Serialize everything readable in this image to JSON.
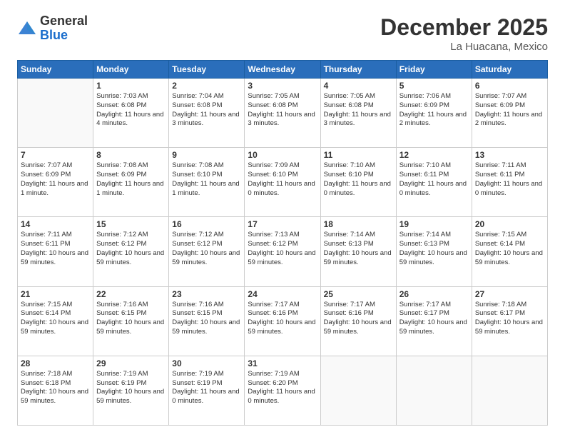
{
  "header": {
    "logo_general": "General",
    "logo_blue": "Blue",
    "month_title": "December 2025",
    "location": "La Huacana, Mexico"
  },
  "calendar": {
    "days_of_week": [
      "Sunday",
      "Monday",
      "Tuesday",
      "Wednesday",
      "Thursday",
      "Friday",
      "Saturday"
    ],
    "weeks": [
      [
        {
          "day": "",
          "info": ""
        },
        {
          "day": "1",
          "info": "Sunrise: 7:03 AM\nSunset: 6:08 PM\nDaylight: 11 hours\nand 4 minutes."
        },
        {
          "day": "2",
          "info": "Sunrise: 7:04 AM\nSunset: 6:08 PM\nDaylight: 11 hours\nand 3 minutes."
        },
        {
          "day": "3",
          "info": "Sunrise: 7:05 AM\nSunset: 6:08 PM\nDaylight: 11 hours\nand 3 minutes."
        },
        {
          "day": "4",
          "info": "Sunrise: 7:05 AM\nSunset: 6:08 PM\nDaylight: 11 hours\nand 3 minutes."
        },
        {
          "day": "5",
          "info": "Sunrise: 7:06 AM\nSunset: 6:09 PM\nDaylight: 11 hours\nand 2 minutes."
        },
        {
          "day": "6",
          "info": "Sunrise: 7:07 AM\nSunset: 6:09 PM\nDaylight: 11 hours\nand 2 minutes."
        }
      ],
      [
        {
          "day": "7",
          "info": "Sunrise: 7:07 AM\nSunset: 6:09 PM\nDaylight: 11 hours\nand 1 minute."
        },
        {
          "day": "8",
          "info": "Sunrise: 7:08 AM\nSunset: 6:09 PM\nDaylight: 11 hours\nand 1 minute."
        },
        {
          "day": "9",
          "info": "Sunrise: 7:08 AM\nSunset: 6:10 PM\nDaylight: 11 hours\nand 1 minute."
        },
        {
          "day": "10",
          "info": "Sunrise: 7:09 AM\nSunset: 6:10 PM\nDaylight: 11 hours\nand 0 minutes."
        },
        {
          "day": "11",
          "info": "Sunrise: 7:10 AM\nSunset: 6:10 PM\nDaylight: 11 hours\nand 0 minutes."
        },
        {
          "day": "12",
          "info": "Sunrise: 7:10 AM\nSunset: 6:11 PM\nDaylight: 11 hours\nand 0 minutes."
        },
        {
          "day": "13",
          "info": "Sunrise: 7:11 AM\nSunset: 6:11 PM\nDaylight: 11 hours\nand 0 minutes."
        }
      ],
      [
        {
          "day": "14",
          "info": "Sunrise: 7:11 AM\nSunset: 6:11 PM\nDaylight: 10 hours\nand 59 minutes."
        },
        {
          "day": "15",
          "info": "Sunrise: 7:12 AM\nSunset: 6:12 PM\nDaylight: 10 hours\nand 59 minutes."
        },
        {
          "day": "16",
          "info": "Sunrise: 7:12 AM\nSunset: 6:12 PM\nDaylight: 10 hours\nand 59 minutes."
        },
        {
          "day": "17",
          "info": "Sunrise: 7:13 AM\nSunset: 6:12 PM\nDaylight: 10 hours\nand 59 minutes."
        },
        {
          "day": "18",
          "info": "Sunrise: 7:14 AM\nSunset: 6:13 PM\nDaylight: 10 hours\nand 59 minutes."
        },
        {
          "day": "19",
          "info": "Sunrise: 7:14 AM\nSunset: 6:13 PM\nDaylight: 10 hours\nand 59 minutes."
        },
        {
          "day": "20",
          "info": "Sunrise: 7:15 AM\nSunset: 6:14 PM\nDaylight: 10 hours\nand 59 minutes."
        }
      ],
      [
        {
          "day": "21",
          "info": "Sunrise: 7:15 AM\nSunset: 6:14 PM\nDaylight: 10 hours\nand 59 minutes."
        },
        {
          "day": "22",
          "info": "Sunrise: 7:16 AM\nSunset: 6:15 PM\nDaylight: 10 hours\nand 59 minutes."
        },
        {
          "day": "23",
          "info": "Sunrise: 7:16 AM\nSunset: 6:15 PM\nDaylight: 10 hours\nand 59 minutes."
        },
        {
          "day": "24",
          "info": "Sunrise: 7:17 AM\nSunset: 6:16 PM\nDaylight: 10 hours\nand 59 minutes."
        },
        {
          "day": "25",
          "info": "Sunrise: 7:17 AM\nSunset: 6:16 PM\nDaylight: 10 hours\nand 59 minutes."
        },
        {
          "day": "26",
          "info": "Sunrise: 7:17 AM\nSunset: 6:17 PM\nDaylight: 10 hours\nand 59 minutes."
        },
        {
          "day": "27",
          "info": "Sunrise: 7:18 AM\nSunset: 6:17 PM\nDaylight: 10 hours\nand 59 minutes."
        }
      ],
      [
        {
          "day": "28",
          "info": "Sunrise: 7:18 AM\nSunset: 6:18 PM\nDaylight: 10 hours\nand 59 minutes."
        },
        {
          "day": "29",
          "info": "Sunrise: 7:19 AM\nSunset: 6:19 PM\nDaylight: 10 hours\nand 59 minutes."
        },
        {
          "day": "30",
          "info": "Sunrise: 7:19 AM\nSunset: 6:19 PM\nDaylight: 11 hours\nand 0 minutes."
        },
        {
          "day": "31",
          "info": "Sunrise: 7:19 AM\nSunset: 6:20 PM\nDaylight: 11 hours\nand 0 minutes."
        },
        {
          "day": "",
          "info": ""
        },
        {
          "day": "",
          "info": ""
        },
        {
          "day": "",
          "info": ""
        }
      ]
    ]
  }
}
